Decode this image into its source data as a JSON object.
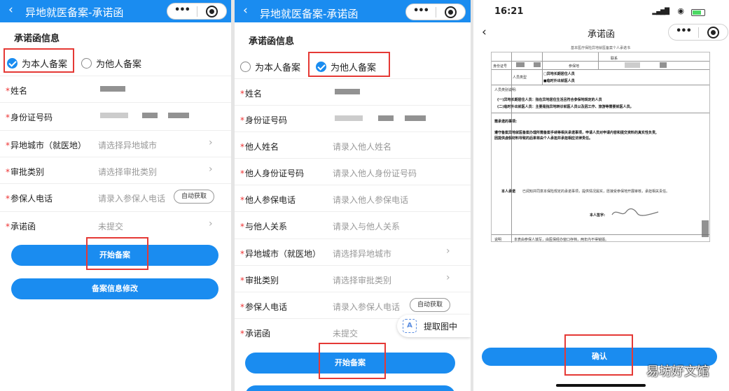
{
  "panel1": {
    "title": "异地就医备案-承诺函",
    "section_title": "承诺函信息",
    "radio_self": "为本人备案",
    "radio_other": "为他人备案",
    "rows": [
      {
        "label": "姓名",
        "value": ""
      },
      {
        "label": "身份证号码",
        "value": ""
      },
      {
        "label": "异地城市（就医地）",
        "value": "请选择异地城市"
      },
      {
        "label": "审批类别",
        "value": "请选择审批类别"
      },
      {
        "label": "参保人电话",
        "value": "请录入参保人电话"
      },
      {
        "label": "承诺函",
        "value": "未提交"
      }
    ],
    "fetch_label": "自动获取",
    "start_button": "开始备案",
    "modify_button": "备案信息修改"
  },
  "panel2": {
    "title": "异地就医备案-承诺函",
    "section_title": "承诺函信息",
    "radio_self": "为本人备案",
    "radio_other": "为他人备案",
    "rows": [
      {
        "label": "姓名",
        "value": ""
      },
      {
        "label": "身份证号码",
        "value": ""
      },
      {
        "label": "他人姓名",
        "value": "请录入他人姓名"
      },
      {
        "label": "他人身份证号码",
        "value": "请录入他人身份证号码"
      },
      {
        "label": "他人参保电话",
        "value": "请录入他人参保电话"
      },
      {
        "label": "与他人关系",
        "value": "请录入与他人关系"
      },
      {
        "label": "异地城市（就医地）",
        "value": "请选择异地城市"
      },
      {
        "label": "审批类别",
        "value": "请选择审批类别"
      },
      {
        "label": "参保人电话",
        "value": "请录入参保人电话"
      },
      {
        "label": "承诺函",
        "value": "未提交"
      }
    ],
    "fetch_label": "自动获取",
    "ocr_label": "提取图中",
    "start_button": "开始备案"
  },
  "panel3": {
    "time": "16:21",
    "title": "承诺函",
    "doc": {
      "title": "基本医疗保险异地就医备案个人承诺书",
      "id_label": "身份证号",
      "insured_label": "参保地",
      "contact_label": "联系",
      "person_type_label": "人员类型",
      "opt_long": "□异地长期居住人员",
      "opt_temp": "■临时外出就医人员",
      "desc_label": "人员类别说明:",
      "desc_1": "(一)异地长期居住人员：指在异地居住生活且符合参保地规定的人员",
      "desc_2": "(二)临时外出就医人员：主要是指异地转诊就医人员以及因工作、旅游等需要就医人员。",
      "promise_label": "需承诺的事项:",
      "promise_1": "遵守备案异地就医备案办理所需备案手续等相关承诺事项，申请人员对申请内容和提交资料的真实性负责,",
      "promise_2": "因提供虚假材料导致的后果将由个人承担并承担相应法律责任。",
      "commit_label": "本人承诺",
      "commit_text": "已阅知并同意本保险规定的承诺事项，提供情况属实，愿接受参保地开展审核，承担相关责任。",
      "sign_label": "本人签字:",
      "note_label": "说明",
      "note_text": "本表由参保人填写，由医保经办窗口存档，两年内不得销毁。"
    },
    "confirm_button": "确认",
    "watermark": "易坊好文馆"
  }
}
